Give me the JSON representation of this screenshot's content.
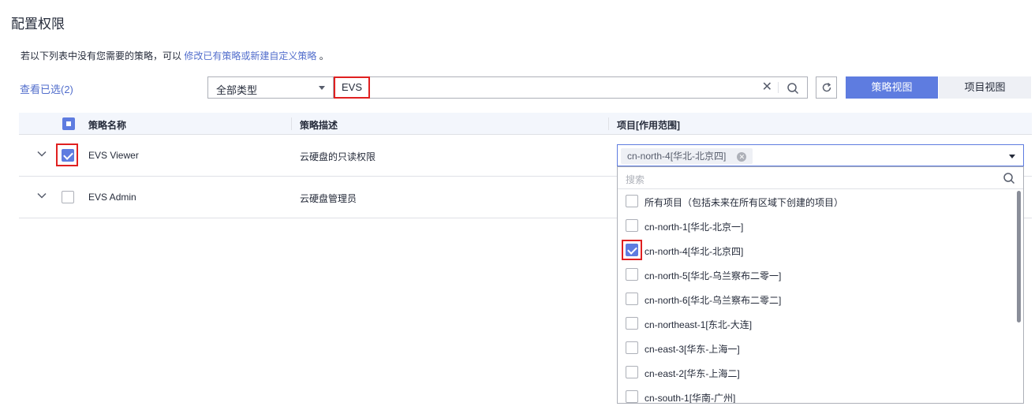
{
  "page": {
    "title": "配置权限"
  },
  "hint": {
    "prefix": "若以下列表中没有您需要的策略，可以",
    "link": "修改已有策略或新建自定义策略",
    "suffix": "。"
  },
  "toolbar": {
    "view_selected": "查看已选(2)",
    "type_select": "全部类型",
    "search_value": "EVS",
    "policy_view": "策略视图",
    "project_view": "项目视图"
  },
  "table": {
    "headers": [
      "策略名称",
      "策略描述",
      "项目[作用范围]"
    ],
    "rows": [
      {
        "name": "EVS Viewer",
        "desc": "云硬盘的只读权限",
        "checked": true
      },
      {
        "name": "EVS Admin",
        "desc": "云硬盘管理员",
        "checked": false
      }
    ]
  },
  "project_select": {
    "selected_tag": "cn-north-4[华北-北京四]",
    "search_placeholder": "搜索",
    "options": [
      {
        "label": "所有项目（包括未来在所有区域下创建的项目）",
        "checked": false
      },
      {
        "label": "cn-north-1[华北-北京一]",
        "checked": false
      },
      {
        "label": "cn-north-4[华北-北京四]",
        "checked": true
      },
      {
        "label": "cn-north-5[华北-乌兰察布二零一]",
        "checked": false
      },
      {
        "label": "cn-north-6[华北-乌兰察布二零二]",
        "checked": false
      },
      {
        "label": "cn-northeast-1[东北-大连]",
        "checked": false
      },
      {
        "label": "cn-east-3[华东-上海一]",
        "checked": false
      },
      {
        "label": "cn-east-2[华东-上海二]",
        "checked": false
      },
      {
        "label": "cn-south-1[华南-广州]",
        "checked": false
      }
    ]
  },
  "colors": {
    "accent": "#5e7ce0",
    "link": "#526ecc",
    "highlight": "#e02020"
  }
}
